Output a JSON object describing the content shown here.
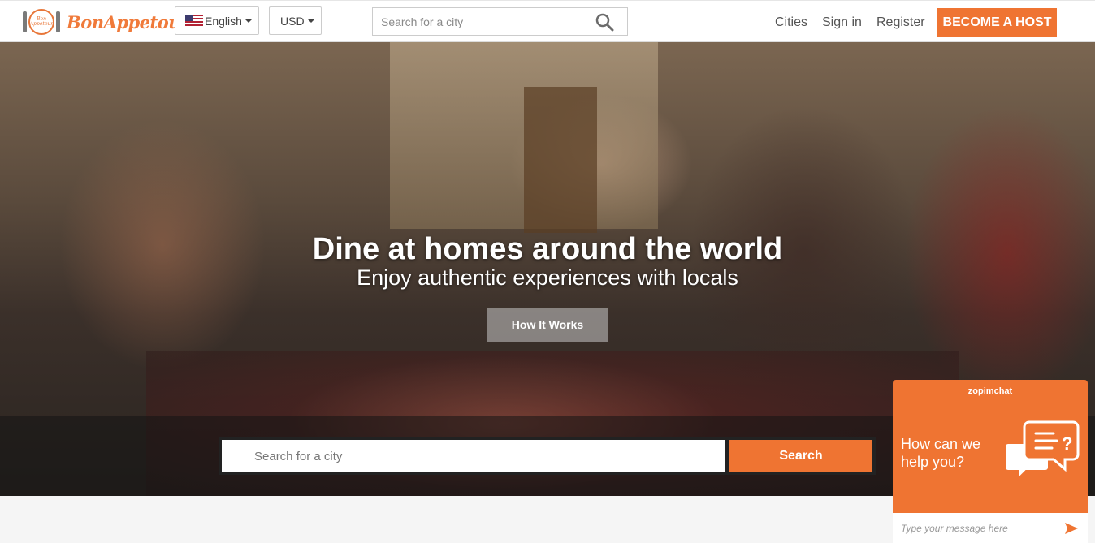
{
  "header": {
    "logo_text": "BonAppetour",
    "logo_plate_text": "Bon Appetour",
    "language_label": "English",
    "currency_label": "USD",
    "search_placeholder": "Search for a city",
    "nav": {
      "cities": "Cities",
      "sign_in": "Sign in",
      "register": "Register"
    },
    "host_button": "BECOME A HOST"
  },
  "hero": {
    "title": "Dine at homes around the world",
    "subtitle": "Enjoy authentic experiences with locals",
    "how_it_works": "How It Works",
    "search_placeholder": "Search for a city",
    "search_button": "Search"
  },
  "chat": {
    "brand": "zopimchat",
    "prompt": "How can we help you?",
    "input_placeholder": "Type your message here"
  },
  "colors": {
    "accent": "#ef7432",
    "header_bg": "#ffffff",
    "page_bg": "#f5f5f5"
  }
}
